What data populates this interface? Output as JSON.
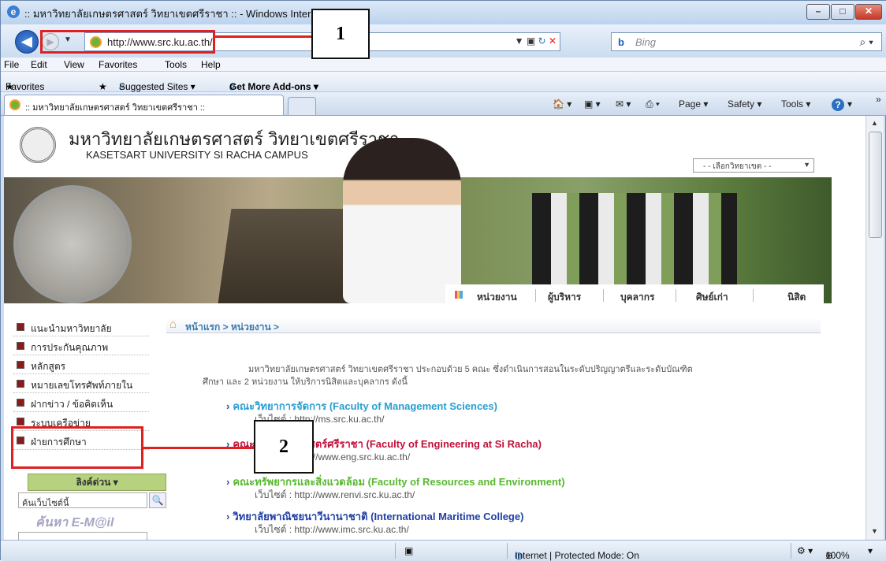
{
  "window": {
    "title": ":: มหาวิทยาลัยเกษตรศาสตร์ วิทยาเขตศรีราชา :: - Windows Internet Explorer",
    "ie_icon": "ie-logo-icon",
    "minimize": "–",
    "maximize": "□",
    "close": "✕"
  },
  "nav": {
    "back": "◀",
    "forward": "▶",
    "url": "http://www.src.ku.ac.th/",
    "search_engine": "Bing",
    "search_placeholder": "Bing"
  },
  "menu": [
    "File",
    "Edit",
    "View",
    "Favorites",
    "Tools",
    "Help"
  ],
  "favorites_bar": {
    "favorites": "Favorites",
    "suggested": "Suggested Sites ▾",
    "addons": "Get More Add-ons ▾"
  },
  "tab": {
    "label": ":: มหาวิทยาลัยเกษตรศาสตร์ วิทยาเขตศรีราชา ::"
  },
  "commands": {
    "page": "Page ▾",
    "safety": "Safety ▾",
    "tools": "Tools ▾",
    "help": "?",
    "chevron": "»"
  },
  "site": {
    "title_th": "มหาวิทยาลัยเกษตรศาสตร์ วิทยาเขตศรีราชา",
    "title_en": "KASETSART UNIVERSITY SI RACHA CAMPUS",
    "campus_select": "- - เลือกวิทยาเขต - -",
    "main_nav": [
      "หน่วยงาน",
      "ผู้บริหาร",
      "บุคลากร",
      "ศิษย์เก่า",
      "นิสิต"
    ],
    "sidebar": [
      "แนะนำมหาวิทยาลัย",
      "การประกันคุณภาพ",
      "หลักสูตร",
      "หมายเลขโทรศัพท์ภายใน",
      "ฝากข่าว / ข้อคิดเห็น",
      "ระบบเครือข่าย",
      "ฝ่ายการศึกษา"
    ],
    "quick_links": "ลิงค์ด่วน ▾",
    "site_search_value": "ค้นเว็บไซต์นี้",
    "search_logo": "ค้นหา E-M@il",
    "breadcrumb": "หน้าแรก > หน่วยงาน >",
    "intro_line1": "มหาวิทยาลัยเกษตรศาสตร์ วิทยาเขตศรีราชา ประกอบด้วย 5 คณะ ซึ่งดำเนินการสอนในระดับปริญญาตรีและระดับบัณฑิต",
    "intro_line2": "ศึกษา และ 2 หน่วยงาน ให้บริการนิสิตและบุคลากร ดังนี้",
    "faculties": [
      {
        "name": "คณะวิทยาการจัดการ (Faculty of Management Sciences)",
        "url": "เว็บไซต์ : http://ms.src.ku.ac.th/",
        "color": "#2a9fd0"
      },
      {
        "name": "คณะวิศวกรรมศาสตร์ศรีราชา (Faculty of Engineering at Si Racha)",
        "url": "เว็บไซต์ : http://www.eng.src.ku.ac.th/",
        "color": "#c0103a"
      },
      {
        "name": "คณะทรัพยากรและสิ่งแวดล้อม (Faculty of Resources and Environment)",
        "url": "เว็บไซต์ : http://www.renvi.src.ku.ac.th/",
        "color": "#58b830"
      },
      {
        "name": "วิทยาลัยพาณิชยนาวีนานาชาติ (International Maritime College)",
        "url": "เว็บไซต์ : http://www.imc.src.ku.ac.th/",
        "color": "#1f3fa6"
      }
    ]
  },
  "status": {
    "zone": "Internet | Protected Mode: On",
    "zoom": "100%"
  },
  "annotations": [
    "1",
    "2"
  ]
}
